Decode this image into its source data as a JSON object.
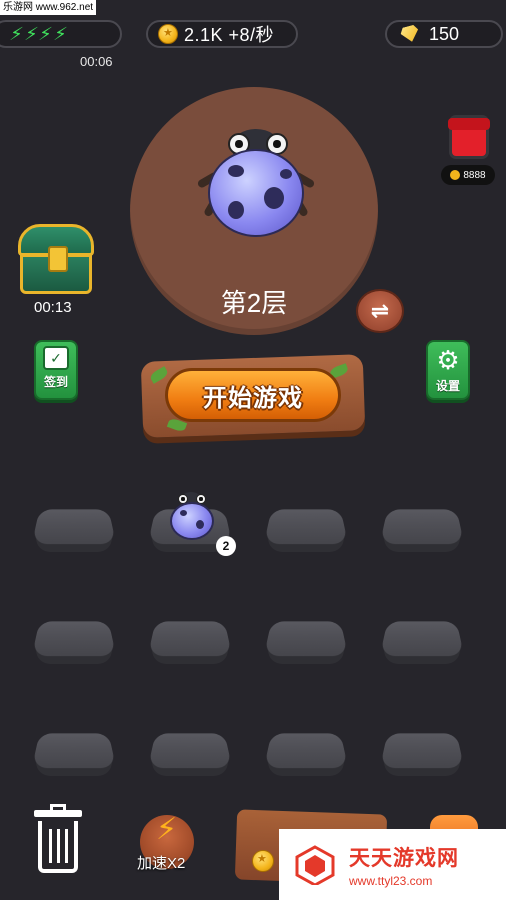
{
  "watermark_top": "乐游网 www.962.net",
  "hud": {
    "energy_bolts": [
      "⚡",
      "⚡",
      "⚡",
      "⚡"
    ],
    "energy_timer": "00:06",
    "coins_text": "2.1K +8/秒",
    "gems_text": "150"
  },
  "floor": {
    "label": "第2层",
    "swap_icon": "⇌"
  },
  "envelope": {
    "badge_value": "8888"
  },
  "chest": {
    "timer": "00:13"
  },
  "buttons": {
    "checkin_label": "签到",
    "settings_label": "设置",
    "start_label": "开始游戏",
    "speed_label": "加速X2"
  },
  "grid": {
    "occupied_slot_level": "2"
  },
  "watermark_bottom": {
    "title": "天天游戏网",
    "url": "www.ttyl23.com"
  },
  "colors": {
    "background": "#26252b",
    "circle": "#7a4d3c",
    "start_orange": "#f07d12",
    "green_button": "#3fbd5a"
  }
}
